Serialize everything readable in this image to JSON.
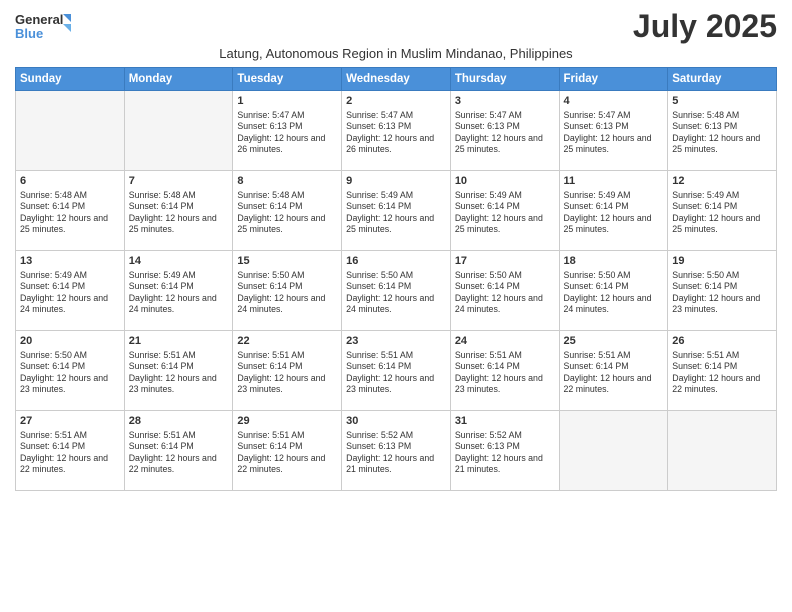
{
  "logo": {
    "line1": "General",
    "line2": "Blue"
  },
  "title": "July 2025",
  "subtitle": "Latung, Autonomous Region in Muslim Mindanao, Philippines",
  "days_header": [
    "Sunday",
    "Monday",
    "Tuesday",
    "Wednesday",
    "Thursday",
    "Friday",
    "Saturday"
  ],
  "weeks": [
    [
      {
        "day": "",
        "info": ""
      },
      {
        "day": "",
        "info": ""
      },
      {
        "day": "1",
        "info": "Sunrise: 5:47 AM\nSunset: 6:13 PM\nDaylight: 12 hours and 26 minutes."
      },
      {
        "day": "2",
        "info": "Sunrise: 5:47 AM\nSunset: 6:13 PM\nDaylight: 12 hours and 26 minutes."
      },
      {
        "day": "3",
        "info": "Sunrise: 5:47 AM\nSunset: 6:13 PM\nDaylight: 12 hours and 25 minutes."
      },
      {
        "day": "4",
        "info": "Sunrise: 5:47 AM\nSunset: 6:13 PM\nDaylight: 12 hours and 25 minutes."
      },
      {
        "day": "5",
        "info": "Sunrise: 5:48 AM\nSunset: 6:13 PM\nDaylight: 12 hours and 25 minutes."
      }
    ],
    [
      {
        "day": "6",
        "info": "Sunrise: 5:48 AM\nSunset: 6:14 PM\nDaylight: 12 hours and 25 minutes."
      },
      {
        "day": "7",
        "info": "Sunrise: 5:48 AM\nSunset: 6:14 PM\nDaylight: 12 hours and 25 minutes."
      },
      {
        "day": "8",
        "info": "Sunrise: 5:48 AM\nSunset: 6:14 PM\nDaylight: 12 hours and 25 minutes."
      },
      {
        "day": "9",
        "info": "Sunrise: 5:49 AM\nSunset: 6:14 PM\nDaylight: 12 hours and 25 minutes."
      },
      {
        "day": "10",
        "info": "Sunrise: 5:49 AM\nSunset: 6:14 PM\nDaylight: 12 hours and 25 minutes."
      },
      {
        "day": "11",
        "info": "Sunrise: 5:49 AM\nSunset: 6:14 PM\nDaylight: 12 hours and 25 minutes."
      },
      {
        "day": "12",
        "info": "Sunrise: 5:49 AM\nSunset: 6:14 PM\nDaylight: 12 hours and 25 minutes."
      }
    ],
    [
      {
        "day": "13",
        "info": "Sunrise: 5:49 AM\nSunset: 6:14 PM\nDaylight: 12 hours and 24 minutes."
      },
      {
        "day": "14",
        "info": "Sunrise: 5:49 AM\nSunset: 6:14 PM\nDaylight: 12 hours and 24 minutes."
      },
      {
        "day": "15",
        "info": "Sunrise: 5:50 AM\nSunset: 6:14 PM\nDaylight: 12 hours and 24 minutes."
      },
      {
        "day": "16",
        "info": "Sunrise: 5:50 AM\nSunset: 6:14 PM\nDaylight: 12 hours and 24 minutes."
      },
      {
        "day": "17",
        "info": "Sunrise: 5:50 AM\nSunset: 6:14 PM\nDaylight: 12 hours and 24 minutes."
      },
      {
        "day": "18",
        "info": "Sunrise: 5:50 AM\nSunset: 6:14 PM\nDaylight: 12 hours and 24 minutes."
      },
      {
        "day": "19",
        "info": "Sunrise: 5:50 AM\nSunset: 6:14 PM\nDaylight: 12 hours and 23 minutes."
      }
    ],
    [
      {
        "day": "20",
        "info": "Sunrise: 5:50 AM\nSunset: 6:14 PM\nDaylight: 12 hours and 23 minutes."
      },
      {
        "day": "21",
        "info": "Sunrise: 5:51 AM\nSunset: 6:14 PM\nDaylight: 12 hours and 23 minutes."
      },
      {
        "day": "22",
        "info": "Sunrise: 5:51 AM\nSunset: 6:14 PM\nDaylight: 12 hours and 23 minutes."
      },
      {
        "day": "23",
        "info": "Sunrise: 5:51 AM\nSunset: 6:14 PM\nDaylight: 12 hours and 23 minutes."
      },
      {
        "day": "24",
        "info": "Sunrise: 5:51 AM\nSunset: 6:14 PM\nDaylight: 12 hours and 23 minutes."
      },
      {
        "day": "25",
        "info": "Sunrise: 5:51 AM\nSunset: 6:14 PM\nDaylight: 12 hours and 22 minutes."
      },
      {
        "day": "26",
        "info": "Sunrise: 5:51 AM\nSunset: 6:14 PM\nDaylight: 12 hours and 22 minutes."
      }
    ],
    [
      {
        "day": "27",
        "info": "Sunrise: 5:51 AM\nSunset: 6:14 PM\nDaylight: 12 hours and 22 minutes."
      },
      {
        "day": "28",
        "info": "Sunrise: 5:51 AM\nSunset: 6:14 PM\nDaylight: 12 hours and 22 minutes."
      },
      {
        "day": "29",
        "info": "Sunrise: 5:51 AM\nSunset: 6:14 PM\nDaylight: 12 hours and 22 minutes."
      },
      {
        "day": "30",
        "info": "Sunrise: 5:52 AM\nSunset: 6:13 PM\nDaylight: 12 hours and 21 minutes."
      },
      {
        "day": "31",
        "info": "Sunrise: 5:52 AM\nSunset: 6:13 PM\nDaylight: 12 hours and 21 minutes."
      },
      {
        "day": "",
        "info": ""
      },
      {
        "day": "",
        "info": ""
      }
    ]
  ]
}
